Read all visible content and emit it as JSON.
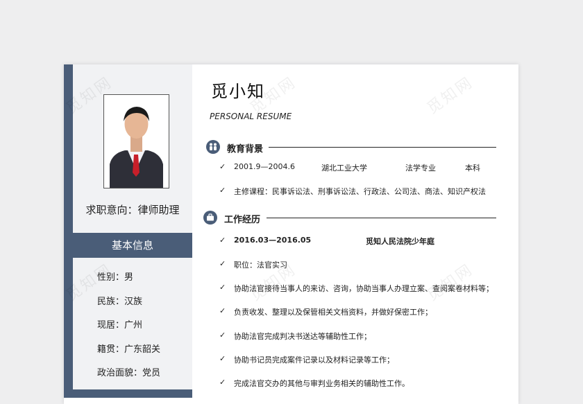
{
  "watermark": "觅知网",
  "resume": {
    "name": "觅小知",
    "subtitle": "PERSONAL RESUME",
    "job_intent": "求职意向：律师助理",
    "basic_info": {
      "header": "基本信息",
      "items": [
        "性别：男",
        "民族：汉族",
        "现居：广州",
        "籍贯：广东韶关",
        "政治面貌：党员"
      ]
    },
    "education": {
      "title": "教育背景",
      "period": "2001.9—2004.6",
      "school": "湖北工业大学",
      "major": "法学专业",
      "degree": "本科",
      "courses": "主修课程：民事诉讼法、刑事诉讼法、行政法、公司法、商法、知识产权法"
    },
    "work": {
      "title": "工作经历",
      "period": "2016.03—2016.05",
      "employer": "觅知人民法院少年庭",
      "duties": [
        "职位：法官实习",
        "协助法官接待当事人的来访、咨询，协助当事人办理立案、查阅案卷材料等；",
        "负责收发、整理以及保管相关文档资料，并做好保密工作；",
        "协助法官完成判决书送达等辅助性工作；",
        "协助书记员完成案件记录以及材料记录等工作；",
        "完成法官交办的其他与审判业务相关的辅助性工作。"
      ]
    }
  },
  "colors": {
    "accent": "#4a5d78",
    "panel": "#f1f2f4",
    "background": "#eeeeef"
  },
  "icons": {
    "education": "people-icon",
    "work": "briefcase-icon",
    "bullet": "check-icon"
  }
}
